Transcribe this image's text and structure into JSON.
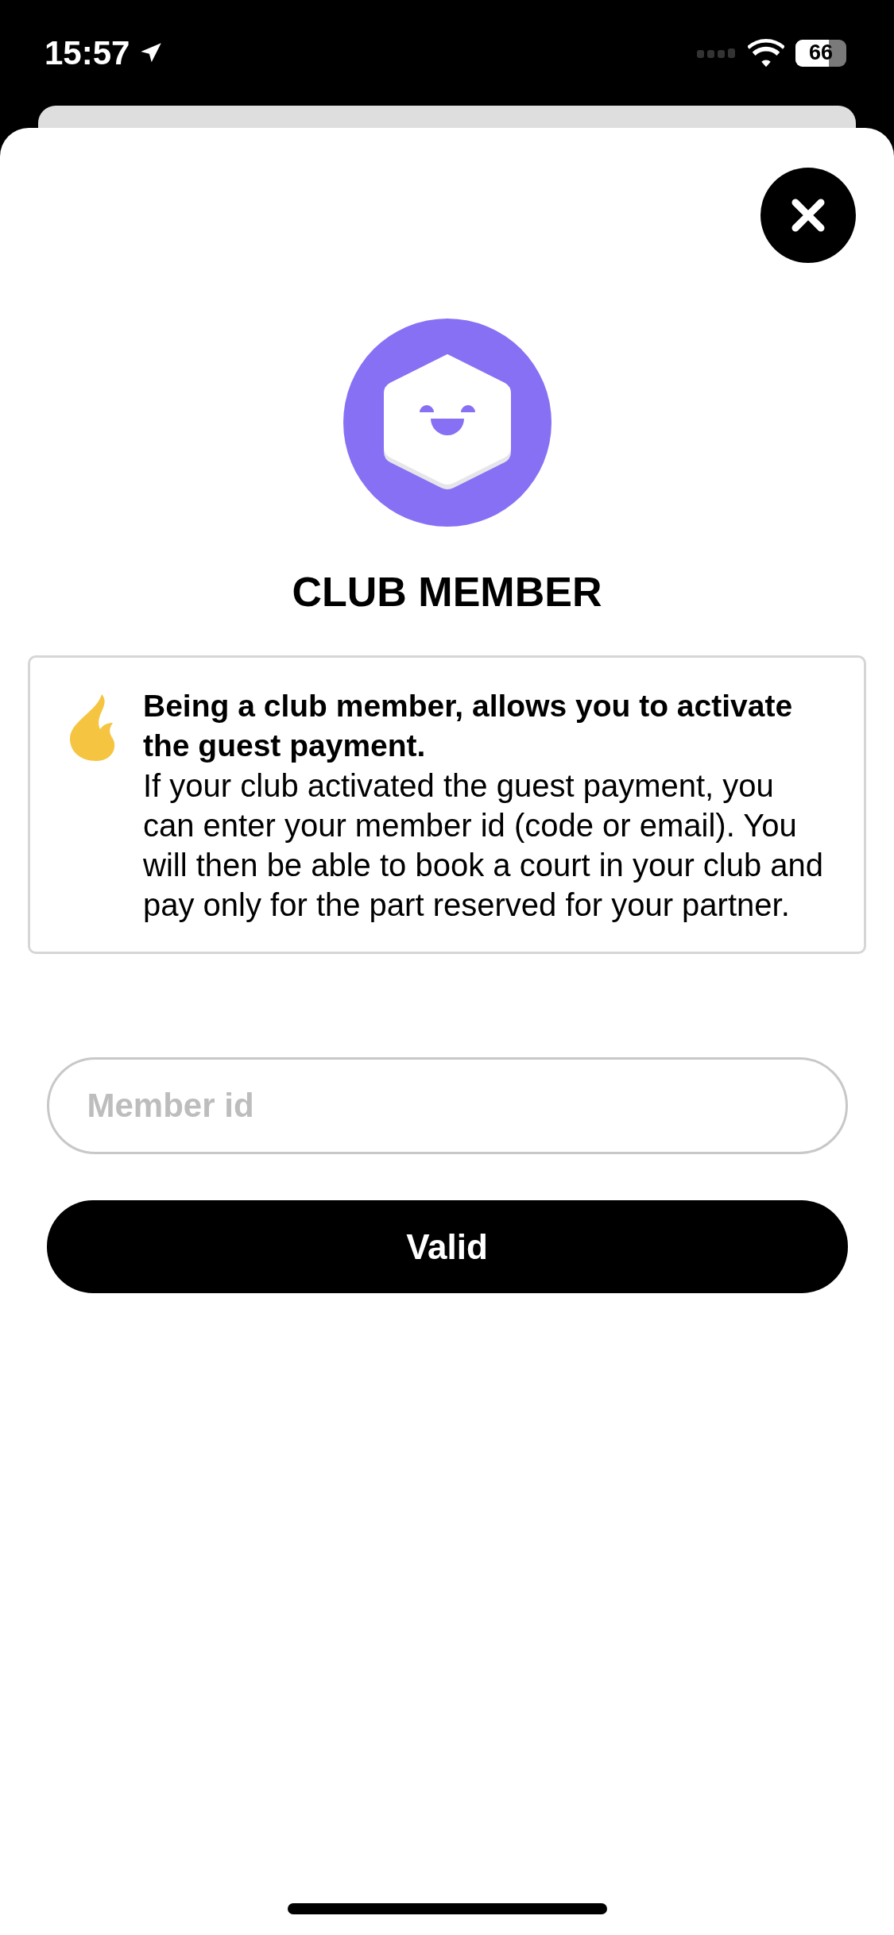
{
  "status_bar": {
    "time": "15:57",
    "battery": "66"
  },
  "sheet": {
    "title": "CLUB MEMBER",
    "info": {
      "heading": "Being a club member, allows you to activate the guest payment.",
      "body": "If your club activated the guest payment, you can enter your member id (code or email). You will then be able to book a court in your club and pay only for the part reserved for your partner."
    },
    "member_field": {
      "placeholder": "Member id"
    },
    "submit_button": {
      "label": "Valid"
    }
  }
}
